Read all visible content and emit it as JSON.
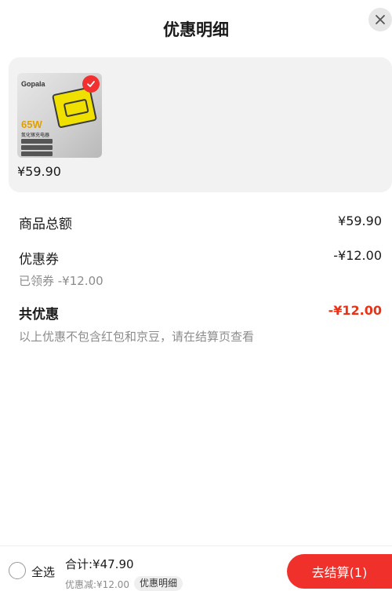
{
  "header": {
    "title": "优惠明细",
    "close_icon": "close-icon"
  },
  "product": {
    "image_brand": "Gopala",
    "image_badge": "65W",
    "image_subtitle": "氮化镓充电器",
    "selected_icon": "check-icon",
    "price": "¥59.90"
  },
  "summary": {
    "goods_total_label": "商品总额",
    "goods_total_value": "¥59.90",
    "coupon_label": "优惠券",
    "coupon_value": "-¥12.00",
    "coupon_claimed": "已领券 -¥12.00",
    "total_discount_label": "共优惠",
    "total_discount_value": "-¥12.00",
    "note": "以上优惠不包含红包和京豆，请在结算页查看"
  },
  "bottom_bar": {
    "select_all_label": "全选",
    "total_text": "合计:¥47.90",
    "discount_text": "优惠减:¥12.00",
    "detail_button": "优惠明细",
    "checkout_button": "去结算(1)"
  },
  "colors": {
    "accent_red": "#f0302a",
    "discount_red": "#e83318",
    "card_bg": "#f2f2f2"
  }
}
